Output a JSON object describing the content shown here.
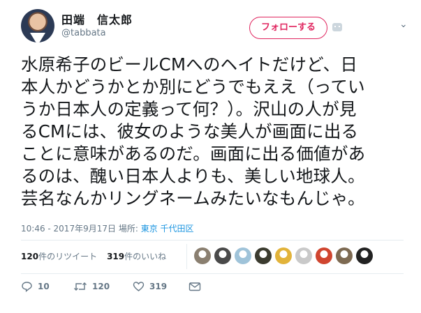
{
  "user": {
    "display_name": "田端　信太郎",
    "screen_name": "@tabbata",
    "follow_label": "フォローする"
  },
  "tweet": {
    "text": "水原希子のビールCMへのヘイトだけど、日\n本人かどうかとか別にどうでもええ（ってい\nうか日本人の定義って何？）。沢山の人が見\nるCMには、彼女のような美人が画面に出る\nことに意味があるのだ。画面に出る価値があ\nるのは、醜い日本人よりも、美しい地球人。\n芸名なんかリングネームみたいなもんじゃ。"
  },
  "meta": {
    "time": "10:46 - 2017年9月17日",
    "place_label": "場所:",
    "location": "東京 千代田区"
  },
  "stats": {
    "retweets_count": "120",
    "retweets_label": "件のリツイート",
    "likes_count": "319",
    "likes_label": "件のいいね"
  },
  "likers": [
    {
      "icon": "liker-avatar-1",
      "color": "#8a7f70"
    },
    {
      "icon": "liker-avatar-2",
      "color": "#4a4a4a"
    },
    {
      "icon": "liker-avatar-3",
      "color": "#9fc3d9"
    },
    {
      "icon": "liker-avatar-4",
      "color": "#3b3b2f"
    },
    {
      "icon": "liker-avatar-5",
      "color": "#e2b33a"
    },
    {
      "icon": "liker-avatar-6",
      "color": "#c9c9c9"
    },
    {
      "icon": "liker-avatar-7",
      "color": "#d0452f"
    },
    {
      "icon": "liker-avatar-8",
      "color": "#7d6a52"
    },
    {
      "icon": "liker-avatar-9",
      "color": "#222222"
    }
  ],
  "actions": {
    "reply_count": "10",
    "retweet_count": "120",
    "like_count": "319"
  },
  "colors": {
    "accent": "#e0245e",
    "link": "#1b95e0",
    "muted": "#657786",
    "divider": "#e6ecf0"
  }
}
